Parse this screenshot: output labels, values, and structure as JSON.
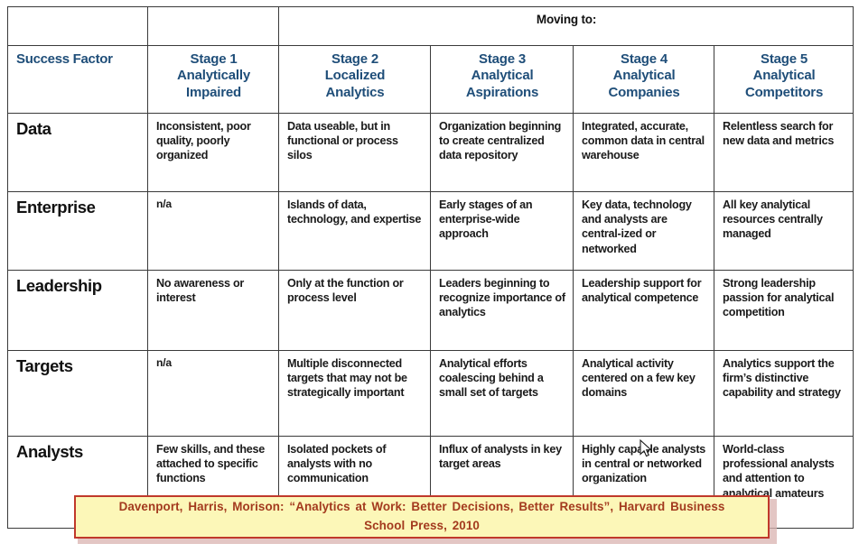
{
  "table": {
    "moving_to_label": "Moving to:",
    "success_factor_label": "Success Factor",
    "stages": [
      {
        "number": "Stage 1",
        "name_line1": "Analytically",
        "name_line2": "Impaired"
      },
      {
        "number": "Stage 2",
        "name_line1": "Localized",
        "name_line2": "Analytics"
      },
      {
        "number": "Stage 3",
        "name_line1": "Analytical",
        "name_line2": "Aspirations"
      },
      {
        "number": "Stage 4",
        "name_line1": "Analytical",
        "name_line2": "Companies"
      },
      {
        "number": "Stage 5",
        "name_line1": "Analytical",
        "name_line2": "Competitors"
      }
    ],
    "rows": [
      {
        "factor": "Data",
        "cells": [
          "Inconsistent, poor quality, poorly organized",
          "Data useable, but in functional or process silos",
          "Organization beginning to create centralized data repository",
          "Integrated, accurate, common data in central warehouse",
          "Relentless search for new data and metrics"
        ]
      },
      {
        "factor": "Enterprise",
        "cells": [
          "n/a",
          "Islands of data, technology, and expertise",
          "Early stages of an enterprise-wide approach",
          "Key data, technology and analysts are central-ized or networked",
          "All key analytical resources centrally managed"
        ]
      },
      {
        "factor": "Leadership",
        "cells": [
          "No awareness or interest",
          "Only at the function or process level",
          "Leaders beginning to recognize importance of analytics",
          "Leadership support for analytical competence",
          "Strong leadership passion for analytical competition"
        ]
      },
      {
        "factor": "Targets",
        "cells": [
          "n/a",
          "Multiple disconnected targets that may not be strategically important",
          "Analytical efforts coalescing behind a small set of targets",
          "Analytical activity centered on a few key domains",
          "Analytics support the firm’s distinctive capability and strategy"
        ]
      },
      {
        "factor": "Analysts",
        "cells": [
          "Few skills, and these attached to specific functions",
          "Isolated pockets of analysts with no communication",
          "Influx of analysts in key target areas",
          "Highly capable analysts in central or networked organization",
          "World-class professional analysts and attention to analytical amateurs"
        ]
      }
    ]
  },
  "citation": {
    "text": "Davenport, Harris, Morison:  “Analytics at Work: Better Decisions,  Better Results”, Harvard Business School Press, 2010"
  },
  "colors": {
    "header_blue": "#1f4e79",
    "grid_line": "#3a3a3a",
    "citation_fill": "#fcf7b8",
    "citation_border": "#c0392b",
    "citation_text": "#a33a1e",
    "body_text": "#1a1a1a"
  }
}
